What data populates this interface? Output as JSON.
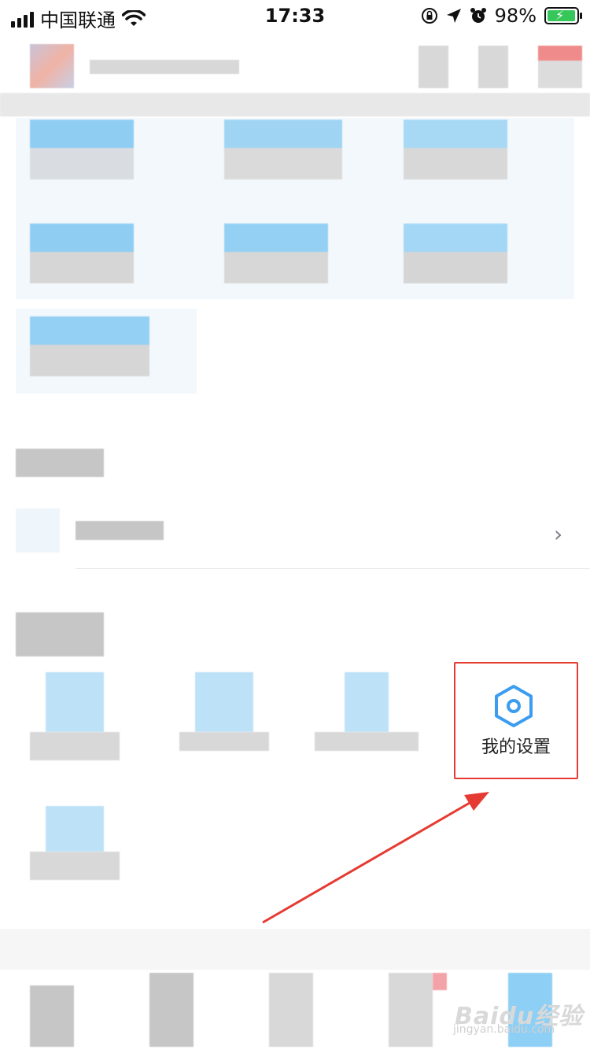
{
  "status_bar": {
    "carrier": "中国联通",
    "time": "17:33",
    "battery_percent": "98%"
  },
  "settings_tile": {
    "label": "我的设置",
    "icon": "hexagon-settings-icon",
    "highlight_color": "#e53b33"
  },
  "annotation": {
    "arrow_color": "#e53b33"
  },
  "watermark": {
    "brand": "Baidu经验",
    "url": "jingyan.baidu.com"
  },
  "colors": {
    "accent": "#3c9df0"
  }
}
